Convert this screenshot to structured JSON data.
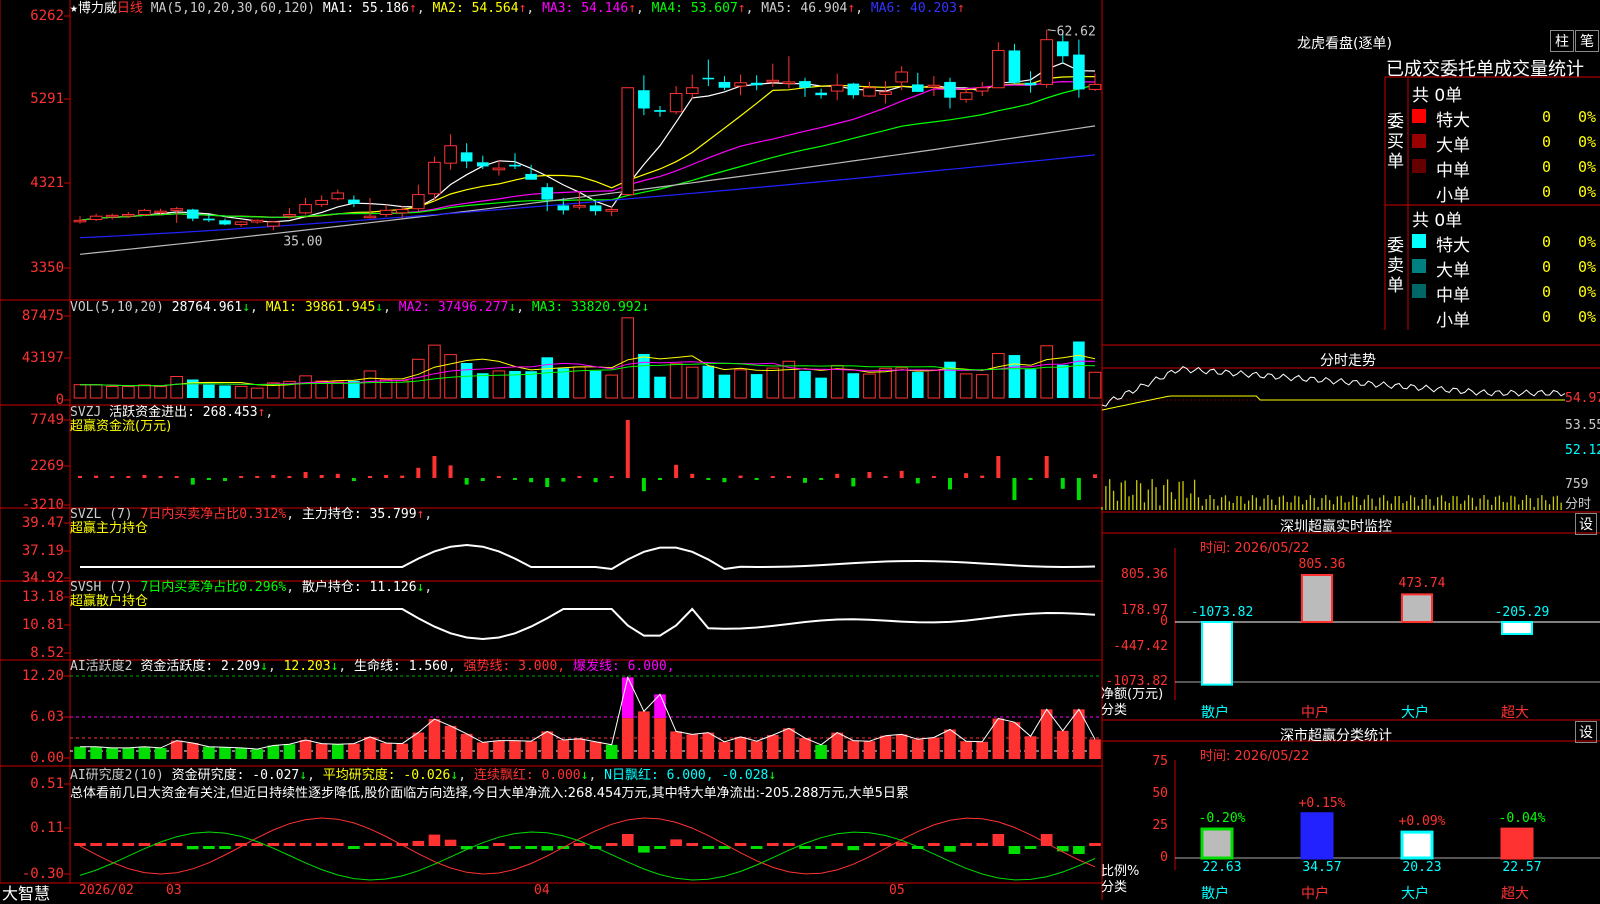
{
  "chart_data": [
    {
      "type": "candlestick",
      "period": "日线",
      "stock": "博力威",
      "ma": {
        "params": "MA(5,10,20,30,60,120)",
        "MA1": "55.186",
        "MA2": "54.564",
        "MA3": "54.146",
        "MA4": "53.607",
        "MA5": "46.904",
        "MA6": "40.203"
      },
      "y_ticks": [
        "6262",
        "5291",
        "4321",
        "3350"
      ],
      "high_label": "62.62",
      "low_label": "35.00",
      "candles": [
        [
          39.6,
          40.1,
          39.2,
          39.6
        ],
        [
          39.7,
          40.4,
          39.5,
          40.1
        ],
        [
          40.1,
          40.4,
          39.7,
          40.2
        ],
        [
          40.3,
          40.6,
          39.9,
          40.3
        ],
        [
          40.3,
          41.0,
          40.1,
          40.8
        ],
        [
          40.6,
          41.0,
          40.3,
          40.7
        ],
        [
          40.8,
          41.2,
          39.3,
          41.0
        ],
        [
          40.9,
          41.0,
          39.5,
          39.8
        ],
        [
          39.8,
          40.3,
          39.4,
          39.6
        ],
        [
          39.6,
          39.8,
          39.0,
          39.1
        ],
        [
          39.1,
          39.5,
          38.8,
          39.4
        ],
        [
          39.4,
          39.7,
          39.2,
          39.6
        ],
        [
          38.9,
          39.5,
          38.4,
          39.4
        ],
        [
          40.1,
          41.1,
          39.8,
          40.3
        ],
        [
          40.5,
          42.3,
          40.3,
          41.5
        ],
        [
          41.5,
          42.6,
          41.2,
          42.0
        ],
        [
          42.2,
          43.3,
          42.0,
          42.9
        ],
        [
          42.1,
          42.6,
          41.2,
          41.6
        ],
        [
          40.1,
          42.3,
          39.8,
          40.1
        ],
        [
          40.3,
          41.5,
          40.0,
          40.8
        ],
        [
          40.5,
          41.3,
          39.9,
          40.9
        ],
        [
          41.0,
          43.9,
          40.7,
          42.7
        ],
        [
          42.8,
          47.3,
          41.9,
          46.6
        ],
        [
          46.5,
          50.0,
          45.7,
          48.6
        ],
        [
          47.8,
          48.9,
          45.9,
          46.7
        ],
        [
          46.6,
          47.4,
          45.8,
          46.1
        ],
        [
          45.7,
          46.9,
          45.0,
          45.9
        ],
        [
          46.3,
          47.7,
          45.8,
          46.1
        ],
        [
          45.2,
          46.3,
          44.5,
          44.5
        ],
        [
          43.6,
          44.1,
          40.7,
          42.1
        ],
        [
          41.4,
          42.3,
          40.3,
          40.8
        ],
        [
          41.2,
          43.1,
          40.9,
          41.4
        ],
        [
          41.4,
          41.9,
          40.2,
          40.7
        ],
        [
          40.7,
          41.3,
          40.1,
          40.9
        ],
        [
          42.7,
          55.6,
          42.7,
          55.6
        ],
        [
          55.3,
          57.1,
          52.3,
          53.1
        ],
        [
          52.9,
          53.4,
          52.1,
          52.7
        ],
        [
          52.7,
          55.8,
          52.4,
          54.9
        ],
        [
          54.9,
          57.2,
          54.3,
          55.6
        ],
        [
          56.8,
          59.0,
          55.8,
          56.7
        ],
        [
          56.3,
          57.0,
          55.3,
          55.6
        ],
        [
          55.8,
          57.2,
          54.7,
          56.2
        ],
        [
          56.2,
          57.1,
          55.3,
          55.9
        ],
        [
          56.3,
          58.5,
          55.7,
          56.5
        ],
        [
          56.2,
          59.4,
          55.5,
          56.3
        ],
        [
          56.4,
          56.8,
          54.5,
          55.6
        ],
        [
          55.0,
          55.5,
          54.3,
          54.7
        ],
        [
          55.2,
          57.3,
          54.1,
          55.9
        ],
        [
          56.1,
          56.2,
          54.3,
          54.7
        ],
        [
          54.6,
          56.3,
          54.5,
          55.6
        ],
        [
          54.8,
          56.4,
          53.7,
          55.1
        ],
        [
          56.3,
          58.2,
          55.3,
          57.5
        ],
        [
          56.0,
          57.4,
          55.3,
          55.1
        ],
        [
          55.7,
          57.0,
          54.6,
          55.9
        ],
        [
          56.3,
          56.8,
          53.1,
          54.4
        ],
        [
          54.2,
          55.6,
          53.8,
          55.0
        ],
        [
          55.2,
          56.3,
          54.6,
          55.6
        ],
        [
          55.6,
          61.1,
          55.6,
          60.1
        ],
        [
          60.1,
          60.9,
          56.0,
          56.2
        ],
        [
          56.2,
          57.6,
          55.0,
          55.9
        ],
        [
          56.0,
          62.6,
          55.6,
          61.4
        ],
        [
          61.2,
          62.1,
          58.6,
          59.4
        ],
        [
          59.6,
          61.4,
          54.4,
          55.4
        ],
        [
          55.4,
          57.3,
          55.2,
          56.0
        ]
      ]
    },
    {
      "type": "bar",
      "label": "VOL(5,10,20)",
      "values_text": {
        "VOL": "28764.961",
        "MA1": "39861.945",
        "MA2": "37496.277",
        "MA3": "33820.992"
      },
      "y_ticks": [
        "87475",
        "43197",
        "0"
      ]
    },
    {
      "type": "bar",
      "label": "SVZJ",
      "title": "活跃资金进出: 268.453",
      "subtitle": "超赢资金流(万元)",
      "y_ticks": [
        "7749",
        "2269",
        "-3210"
      ]
    },
    {
      "type": "line",
      "label": "SVZL (7)",
      "ratio": "7日内买卖净占比0.312%",
      "hold": "主力持仓: 35.799",
      "subtitle": "超赢主力持仓",
      "y_ticks": [
        "39.47",
        "37.19",
        "34.92"
      ]
    },
    {
      "type": "line",
      "label": "SVSH (7)",
      "ratio": "7日内买卖净占比0.296%",
      "hold": "散户持仓: 11.126",
      "subtitle": "超赢散户持仓",
      "y_ticks": [
        "13.18",
        "10.81",
        "8.52"
      ]
    },
    {
      "type": "bar",
      "label": "AI活跃度2",
      "a": "资金活跃度: 2.209",
      "b": "12.203",
      "c": "生命线: 1.560,",
      "d": "强势线: 3.000,",
      "e": "爆发线: 6.000,",
      "y_ticks": [
        "12.20",
        "6.03",
        "0.00"
      ]
    },
    {
      "type": "bar",
      "label": "AI研究度2(10)",
      "a": "资金研究度: -0.027",
      "b": "平均研究度: -0.026",
      "c": "连续飘红: 0.000",
      "d": "N日飘红: 6.000, -0.028",
      "summary": "总体看前几日大资金有关注,但近日持续性逐步降低,股价面临方向选择,今日大单净流入:268.454万元,其中特大单净流出:-205.288万元,大单5日累",
      "y_ticks": [
        "0.51",
        "0.11",
        "-0.30"
      ]
    }
  ],
  "x_axis": [
    "2026/02",
    "03",
    "04",
    "05"
  ],
  "brand": "大智慧",
  "right_panel": {
    "top_title": "龙虎看盘(逐单)",
    "btn1": "柱",
    "btn2": "笔",
    "stats_title": "已成交委托单成交量统计",
    "buy_label": "委买单",
    "sell_label": "委卖单",
    "buy_total": "共 0单",
    "sell_total": "共 0单",
    "buy_rows": [
      {
        "name": "特大",
        "n": "0",
        "p": "0%",
        "color": "#ff0000"
      },
      {
        "name": "大单",
        "n": "0",
        "p": "0%",
        "color": "#990000"
      },
      {
        "name": "中单",
        "n": "0",
        "p": "0%",
        "color": "#660000"
      },
      {
        "name": "小单",
        "n": "0",
        "p": "0%",
        "color": ""
      }
    ],
    "sell_rows": [
      {
        "name": "特大",
        "n": "0",
        "p": "0%",
        "color": "#00ffff"
      },
      {
        "name": "大单",
        "n": "0",
        "p": "0%",
        "color": "#008080"
      },
      {
        "name": "中单",
        "n": "0",
        "p": "0%",
        "color": "#006666"
      },
      {
        "name": "小单",
        "n": "0",
        "p": "0%",
        "color": ""
      }
    ],
    "intraday_title": "分时走势",
    "intraday_ticks": [
      "54.97",
      "53.55",
      "52.12",
      "759",
      "分时"
    ],
    "monitor_title": "深圳超赢实时监控",
    "set_label": "设",
    "monitor_time": "时间: 2026/05/22",
    "monitor_ticks": [
      "805.36",
      "178.97",
      "0",
      "-447.42",
      "-1073.82"
    ],
    "monitor_ylab1": "净额(万元)",
    "monitor_ylab2": "分类",
    "monitor_bars": [
      {
        "cat": "散户",
        "value": -1073.82,
        "label": "-1073.82"
      },
      {
        "cat": "中户",
        "value": 805.36,
        "label": "805.36"
      },
      {
        "cat": "大户",
        "value": 473.74,
        "label": "473.74"
      },
      {
        "cat": "超大",
        "value": -205.29,
        "label": "-205.29"
      }
    ],
    "class_title": "深市超赢分类统计",
    "class_time": "时间: 2026/05/22",
    "class_ticks": [
      "75",
      "50",
      "25",
      "0"
    ],
    "class_ylab1": "比例%",
    "class_ylab2": "分类",
    "class_bars": [
      {
        "cat": "散户",
        "value": 22.63,
        "label": "22.63",
        "change": "-0.20%"
      },
      {
        "cat": "中户",
        "value": 34.57,
        "label": "34.57",
        "change": "+0.15%"
      },
      {
        "cat": "大户",
        "value": 20.23,
        "label": "20.23",
        "change": "+0.09%"
      },
      {
        "cat": "超大",
        "value": 22.57,
        "label": "22.57",
        "change": "-0.04%"
      }
    ]
  },
  "colors": {
    "up": "#ff3232",
    "down": "#00ffff",
    "frame": "#cc0000"
  }
}
